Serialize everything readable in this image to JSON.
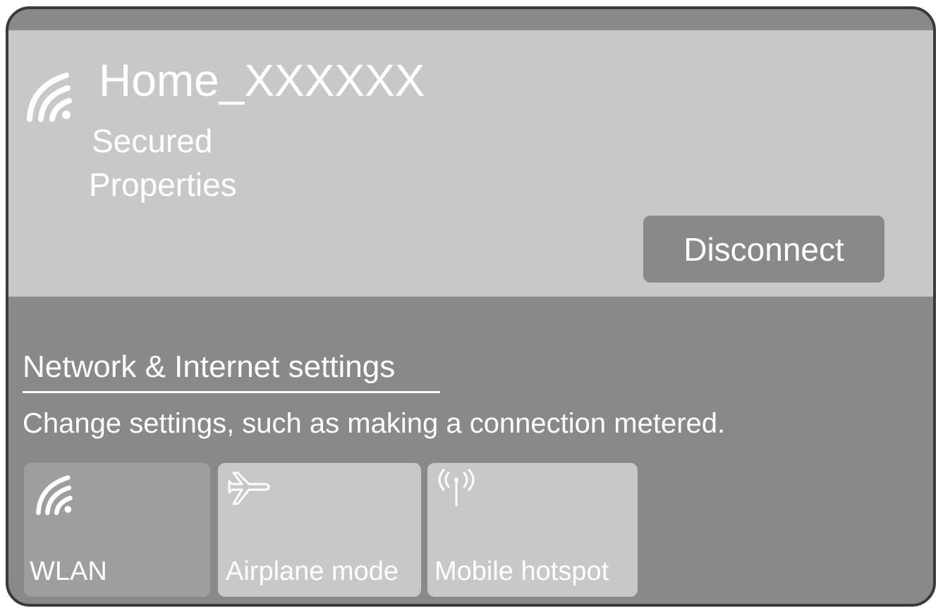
{
  "network": {
    "name": "Home_XXXXXX",
    "status": "Secured",
    "properties_label": "Properties",
    "disconnect_label": "Disconnect",
    "icon": "wifi-icon"
  },
  "settings": {
    "link_label": "Network & Internet settings",
    "description": "Change settings, such as making a connection metered."
  },
  "quick_actions": [
    {
      "label": "WLAN",
      "icon": "wifi-icon",
      "active": true
    },
    {
      "label": "Airplane mode",
      "icon": "airplane-icon",
      "active": false
    },
    {
      "label": "Mobile hotspot",
      "icon": "hotspot-icon",
      "active": false
    }
  ],
  "colors": {
    "panel_background": "#898989",
    "card_background": "#c8c8c8",
    "active_tile": "#9d9e9d",
    "border": "#3a3a3a",
    "text": "#ffffff"
  }
}
